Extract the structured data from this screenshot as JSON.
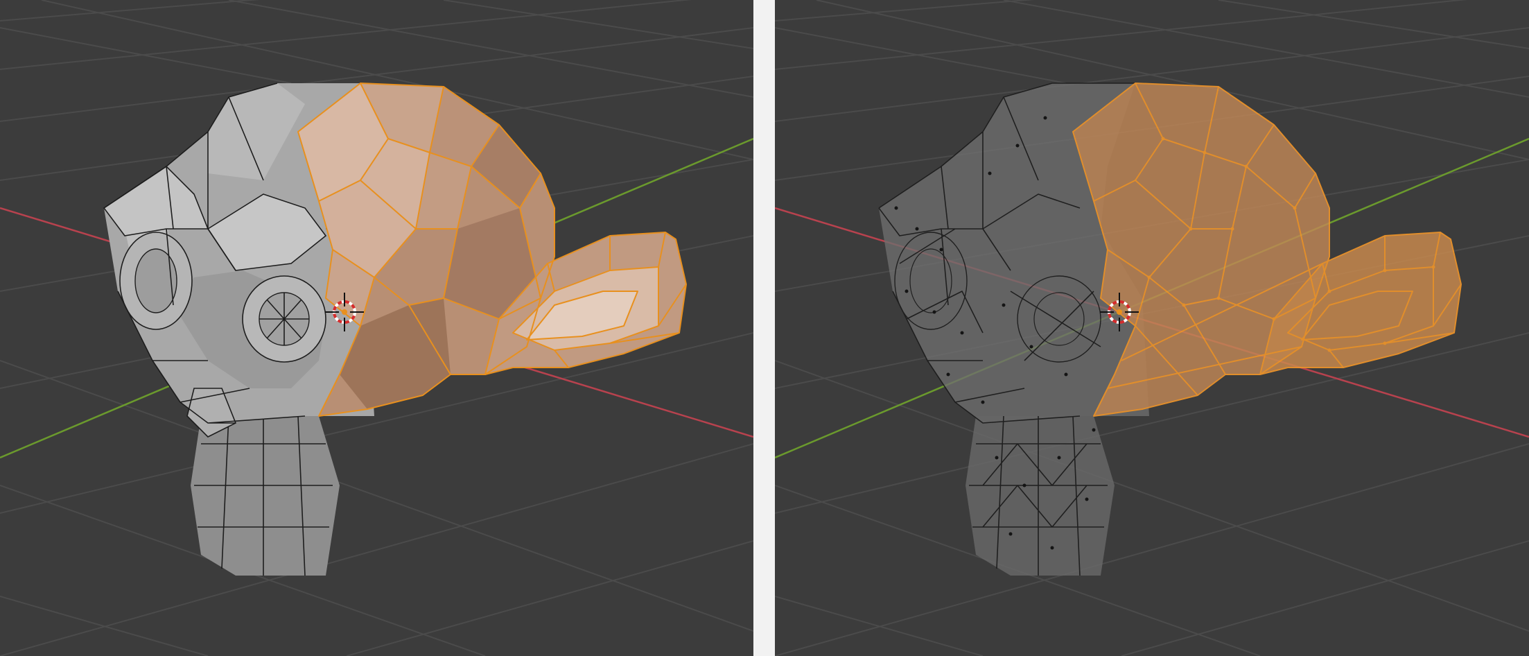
{
  "colors": {
    "background": "#3c3c3c",
    "grid": "#4b4b4b",
    "axis_x": "#b8424e",
    "axis_y": "#6b9a2d",
    "divider": "#f2f2f2",
    "solid_face_light": "#b9b9b9",
    "solid_face_dark": "#7b7b7b",
    "selected_face": "#c89a7c",
    "selected_edge": "#e8901e",
    "wire_face": "#6f6f6f",
    "wire_selected": "#f0952a",
    "cursor_ring_red": "#d62c2c",
    "cursor_ring_white": "#ffffff"
  },
  "viewports": [
    {
      "name": "viewport-solid",
      "shading": "solid",
      "icons": [
        "3d-cursor-icon",
        "suzanne-mesh"
      ]
    },
    {
      "name": "viewport-xray",
      "shading": "xray",
      "icons": [
        "3d-cursor-icon",
        "suzanne-mesh"
      ]
    }
  ]
}
